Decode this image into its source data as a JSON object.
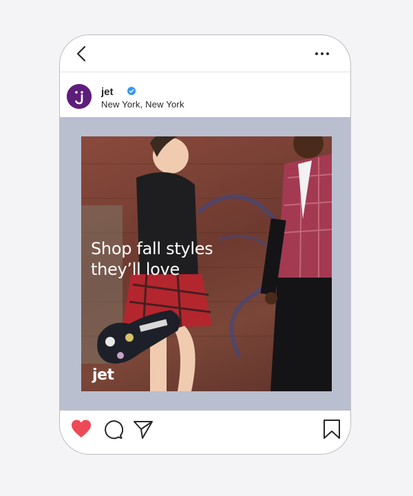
{
  "post": {
    "username": "jet",
    "location": "New York, New York",
    "avatar_letter": "j"
  },
  "ad": {
    "headline_line1": "Shop fall styles",
    "headline_line2": "they’ll love",
    "brand_logo": "jet"
  },
  "colors": {
    "avatar_bg": "#5f1d7a",
    "verified_badge": "#3897f0",
    "like_heart": "#ed4956",
    "media_frame_bg": "#b9bfcf"
  },
  "icons": {
    "back": "chevron-left-icon",
    "more": "ellipsis-icon",
    "verified": "verified-badge-icon",
    "like": "heart-icon",
    "comment": "comment-bubble-icon",
    "share": "paper-plane-icon",
    "save": "bookmark-icon"
  },
  "state": {
    "liked": true
  }
}
